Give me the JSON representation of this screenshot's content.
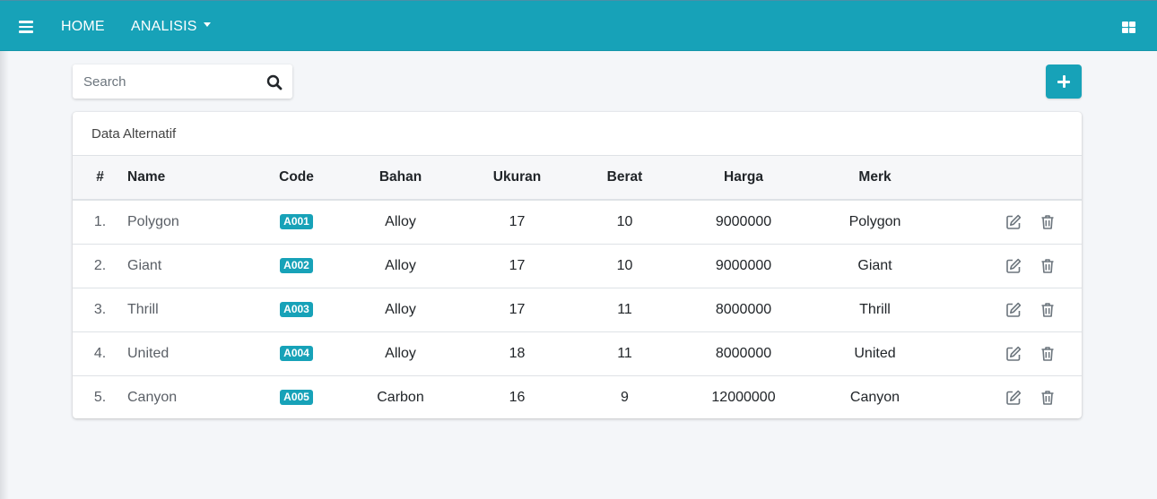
{
  "navbar": {
    "home_label": "HOME",
    "analisis_label": "ANALISIS",
    "color": "#17a2b8"
  },
  "search": {
    "placeholder": "Search",
    "value": ""
  },
  "card": {
    "title": "Data Alternatif"
  },
  "table": {
    "columns": [
      "#",
      "Name",
      "Code",
      "Bahan",
      "Ukuran",
      "Berat",
      "Harga",
      "Merk"
    ],
    "rows": [
      {
        "no": "1.",
        "name": "Polygon",
        "code": "A001",
        "bahan": "Alloy",
        "ukuran": "17",
        "berat": "10",
        "harga": "9000000",
        "merk": "Polygon"
      },
      {
        "no": "2.",
        "name": "Giant",
        "code": "A002",
        "bahan": "Alloy",
        "ukuran": "17",
        "berat": "10",
        "harga": "9000000",
        "merk": "Giant"
      },
      {
        "no": "3.",
        "name": "Thrill",
        "code": "A003",
        "bahan": "Alloy",
        "ukuran": "17",
        "berat": "11",
        "harga": "8000000",
        "merk": "Thrill"
      },
      {
        "no": "4.",
        "name": "United",
        "code": "A004",
        "bahan": "Alloy",
        "ukuran": "18",
        "berat": "11",
        "harga": "8000000",
        "merk": "United"
      },
      {
        "no": "5.",
        "name": "Canyon",
        "code": "A005",
        "bahan": "Carbon",
        "ukuran": "16",
        "berat": "9",
        "harga": "12000000",
        "merk": "Canyon"
      }
    ]
  },
  "icons": {
    "menu": "hamburger-menu-icon",
    "layout": "grid-layout-icon",
    "search": "search-icon",
    "add": "plus-icon",
    "edit": "edit-icon",
    "delete": "trash-icon"
  }
}
